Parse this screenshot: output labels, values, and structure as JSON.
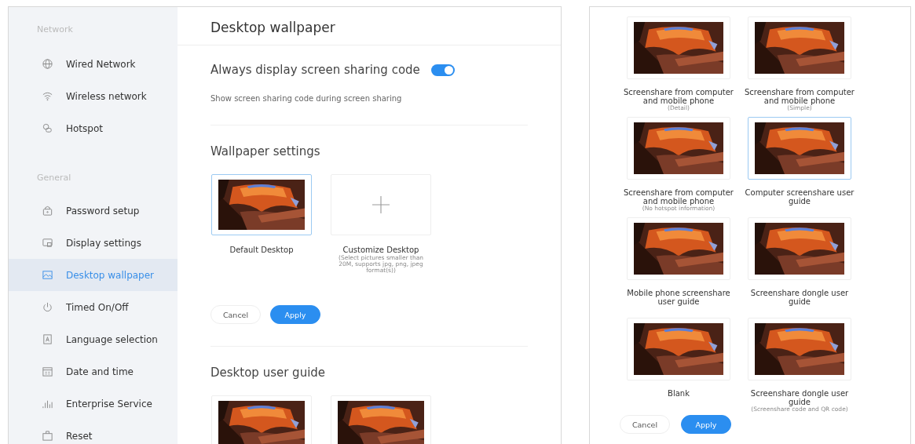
{
  "sidebar": {
    "sections": [
      {
        "label": "Network",
        "items": [
          {
            "label": "Wired Network",
            "selected": false
          },
          {
            "label": "Wireless network",
            "selected": false
          },
          {
            "label": "Hotspot",
            "selected": false
          }
        ]
      },
      {
        "label": "General",
        "items": [
          {
            "label": "Password setup",
            "selected": false
          },
          {
            "label": "Display settings",
            "selected": false
          },
          {
            "label": "Desktop wallpaper",
            "selected": true
          },
          {
            "label": "Timed On/Off",
            "selected": false
          },
          {
            "label": "Language selection",
            "selected": false
          },
          {
            "label": "Date and time",
            "selected": false
          },
          {
            "label": "Enterprise Service",
            "selected": false
          },
          {
            "label": "Reset",
            "selected": false
          }
        ]
      }
    ]
  },
  "page_title": "Desktop wallpaper",
  "sharing_code": {
    "label": "Always display screen sharing code",
    "on": true,
    "description": "Show screen sharing code during screen sharing"
  },
  "wallpaper_settings": {
    "title": "Wallpaper settings",
    "options": [
      {
        "kind": "picture",
        "label": "Default Desktop",
        "selected": true
      },
      {
        "kind": "add",
        "label": "Customize Desktop",
        "note": "(Select pictures smaller than 20M, supports jpg, png, jpeg format(s))",
        "selected": false
      }
    ],
    "buttons": [
      {
        "label": "Cancel",
        "kind": "secondary"
      },
      {
        "label": "Apply",
        "kind": "primary"
      }
    ]
  },
  "desktop_user_guide": {
    "title": "Desktop user guide"
  },
  "guide_panel": {
    "options": [
      {
        "label": "Screenshare from computer and mobile phone",
        "note": "(Detail)",
        "selected": false
      },
      {
        "label": "Screenshare from computer and mobile phone",
        "note": "(Simple)",
        "selected": false
      },
      {
        "label": "Screenshare from computer and mobile phone",
        "note": "(No hotspot information)",
        "selected": false
      },
      {
        "label": "Computer screenshare user guide",
        "selected": true
      },
      {
        "label": "Mobile phone screenshare user guide",
        "selected": false
      },
      {
        "label": "Screenshare dongle user guide",
        "selected": false
      },
      {
        "label": "Blank",
        "selected": false
      },
      {
        "label": "Screenshare dongle user guide",
        "note": "(Screenshare code and QR code)",
        "selected": false
      }
    ],
    "buttons": [
      {
        "label": "Cancel",
        "kind": "secondary"
      },
      {
        "label": "Apply",
        "kind": "primary"
      }
    ]
  }
}
